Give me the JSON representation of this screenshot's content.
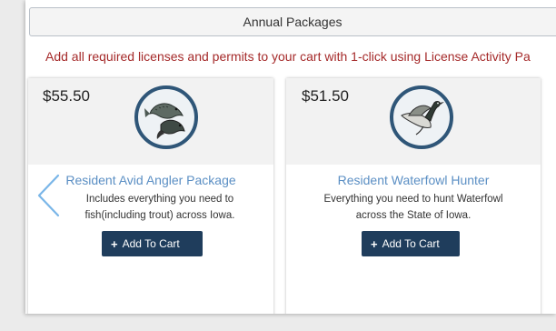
{
  "header": {
    "title": "Annual Packages"
  },
  "subtitle": "Add all required licenses and permits to your cart with 1-click using License Activity Pa",
  "carousel": {
    "prev_icon": "chevron-left-icon",
    "cards": [
      {
        "price": "$55.50",
        "icon": "fish-icon",
        "title": "Resident Avid Angler Package",
        "desc_line1": "Includes everything you need to",
        "desc_line2": "fish(including trout) across Iowa.",
        "button_label": "Add To Cart"
      },
      {
        "price": "$51.50",
        "icon": "duck-icon",
        "title": "Resident Waterfowl Hunter",
        "desc_line1": "Everything you need to hunt Waterfowl",
        "desc_line2": "across the State of Iowa.",
        "button_label": "Add To Cart"
      }
    ]
  },
  "colors": {
    "subtitle": "#a52a2a",
    "card_title": "#5b8fc4",
    "button_bg": "#1f3d5c",
    "badge_ring": "#2f5678"
  }
}
